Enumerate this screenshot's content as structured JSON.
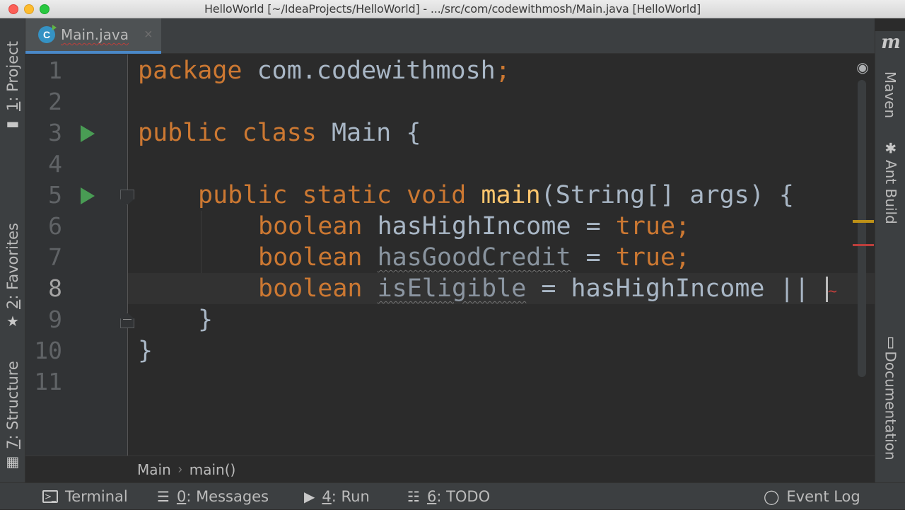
{
  "window": {
    "title": "HelloWorld [~/IdeaProjects/HelloWorld] - .../src/com/codewithmosh/Main.java [HelloWorld]"
  },
  "tab": {
    "file_name": "Main.java",
    "close_glyph": "×",
    "icon_letter": "C"
  },
  "left_tools": {
    "project": {
      "number": "1",
      "label": ": Project"
    },
    "favorites": {
      "number": "2",
      "label": ": Favorites"
    },
    "structure": {
      "number": "7",
      "label": ": Structure"
    }
  },
  "right_tools": {
    "maven_icon": "m",
    "maven": "Maven",
    "ant_build": "Ant Build",
    "documentation": "Documentation"
  },
  "editor": {
    "line_numbers": [
      "1",
      "2",
      "3",
      "4",
      "5",
      "6",
      "7",
      "8",
      "9",
      "10",
      "11"
    ],
    "current_line": 8,
    "lines": {
      "l1": {
        "kw": "package",
        "rest": " com.codewithmosh",
        "semi": ";"
      },
      "l3": {
        "kw1": "public",
        "kw2": "class",
        "name": "Main",
        "brace": "{"
      },
      "l5": {
        "kw1": "public",
        "kw2": "static",
        "kw3": "void",
        "fn": "main",
        "params": "(String[] args) {"
      },
      "l6": {
        "kw": "boolean",
        "var": "hasHighIncome",
        "eq": " = ",
        "val": "true",
        "semi": ";"
      },
      "l7": {
        "kw": "boolean",
        "var": "hasGoodCredit",
        "eq": " = ",
        "val": "true",
        "semi": ";"
      },
      "l8": {
        "kw": "boolean",
        "var": "isEligible",
        "rest": " = hasHighIncome || "
      },
      "l9": {
        "brace": "}"
      },
      "l10": {
        "brace": "}"
      }
    }
  },
  "breadcrumb": {
    "items": [
      "Main",
      "main()"
    ],
    "separator": "›"
  },
  "bottom_tools": {
    "terminal": "Terminal",
    "messages": {
      "number": "0",
      "label": ": Messages"
    },
    "run": {
      "number": "4",
      "label": ": Run"
    },
    "todo": {
      "number": "6",
      "label": ": TODO"
    },
    "event_log": "Event Log"
  },
  "colors": {
    "keyword": "#cc7832",
    "identifier": "#a9b7c6",
    "function": "#ffc66d",
    "run_marker": "#499c54",
    "tab_underline": "#4a88c7"
  }
}
